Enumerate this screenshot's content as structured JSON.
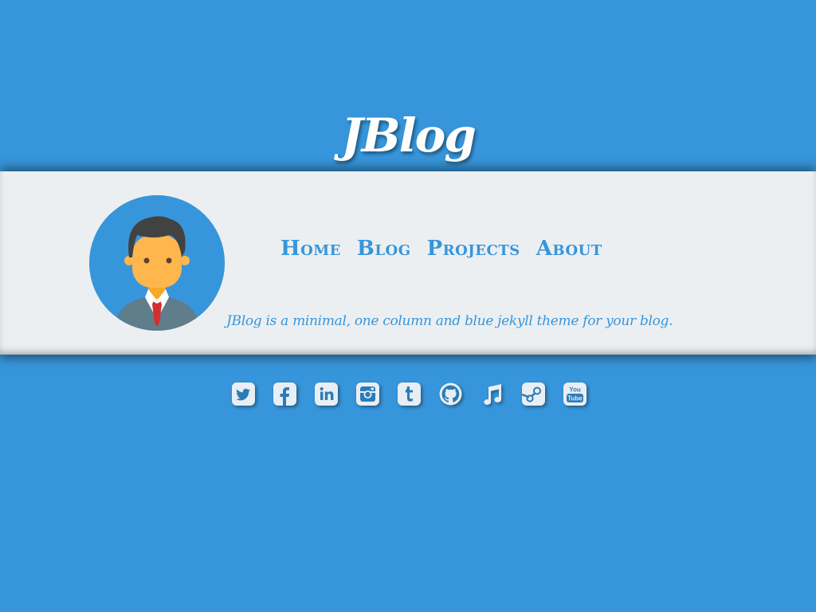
{
  "site": {
    "title": "JBlog",
    "tagline": "JBlog is a minimal, one column and blue jekyll theme for your blog."
  },
  "nav": {
    "items": [
      {
        "label": "Home"
      },
      {
        "label": "Blog"
      },
      {
        "label": "Projects"
      },
      {
        "label": "About"
      }
    ]
  },
  "social": {
    "icons": [
      "twitter-icon",
      "facebook-icon",
      "linkedin-icon",
      "instagram-icon",
      "tumblr-icon",
      "github-icon",
      "music-icon",
      "steam-icon",
      "youtube-icon"
    ]
  },
  "colors": {
    "background": "#3796db",
    "band": "#eceff1",
    "accent": "#3796db",
    "icon_fill": "#e8eef3"
  }
}
